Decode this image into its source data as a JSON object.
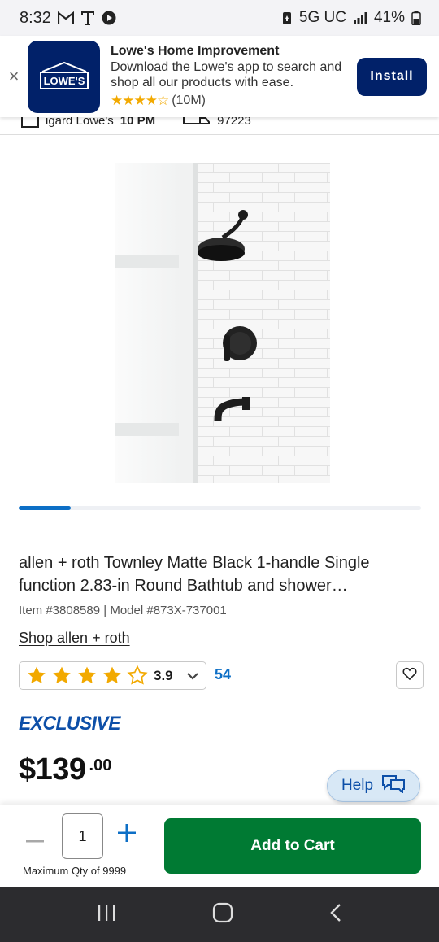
{
  "status_bar": {
    "time": "8:32",
    "network": "5G UC",
    "battery": "41%"
  },
  "app_banner": {
    "close": "×",
    "logo_text": "LOWE'S",
    "title": "Lowe's Home Improvement",
    "description": "Download the Lowe's app to search and shop all our products with ease.",
    "stars": "★★★★☆",
    "rating_count": "(10M)",
    "install_label": "Install"
  },
  "store_strip": {
    "store_partial": "igard Lowe's",
    "hours_partial": "10 PM",
    "zip_partial": "97223"
  },
  "product": {
    "title": "allen + roth Townley Matte Black 1-handle Single function 2.83-in Round Bathtub and shower…",
    "item_number": "Item #3808589",
    "model_number": "Model #873X-737001",
    "shop_link": "Shop allen + roth",
    "rating": "3.9",
    "rating_stars_filled": 4,
    "review_count": "54",
    "badge": "EXCLUSIVE",
    "price_main": "$139",
    "price_cents": ".00",
    "image_position": 1,
    "image_count": 7
  },
  "help_button": {
    "label": "Help"
  },
  "cart": {
    "quantity": "1",
    "max_qty": "Maximum Qty of 9999",
    "add_label": "Add to Cart"
  },
  "colors": {
    "brand_navy": "#012169",
    "accent_blue": "#0d6fc6",
    "cart_green": "#007a33",
    "star_gold": "#f2a900"
  }
}
